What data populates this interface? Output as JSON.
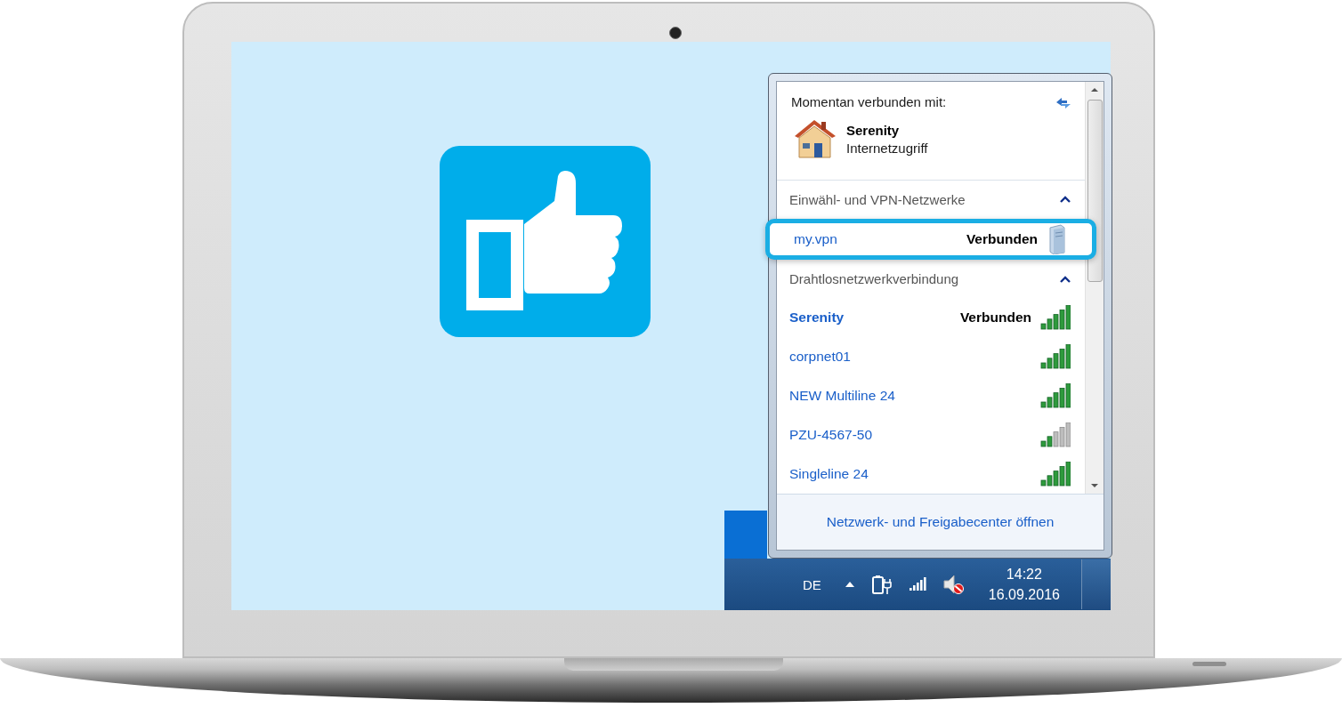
{
  "flyout": {
    "heading": "Momentan verbunden mit:",
    "current": {
      "name": "Serenity",
      "access": "Internetzugriff"
    },
    "sections": [
      {
        "title": "Einwähl- und VPN-Netzwerke",
        "kind": "vpn",
        "expanded": true,
        "items": [
          {
            "name": "my.vpn",
            "status": "Verbunden",
            "highlighted": true
          }
        ]
      },
      {
        "title": "Drahtlosnetzwerkverbindung",
        "kind": "wifi",
        "expanded": true,
        "items": [
          {
            "name": "Serenity",
            "status": "Verbunden",
            "connected": true,
            "level": 1
          },
          {
            "name": "corpnet01",
            "connected": false,
            "level": 1
          },
          {
            "name": "NEW Multiline 24",
            "connected": false,
            "level": 1
          },
          {
            "name": "PZU-4567-50",
            "connected": false,
            "level": 0.4
          },
          {
            "name": "Singleline 24",
            "connected": false,
            "level": 1
          }
        ]
      }
    ],
    "footer_link": "Netzwerk- und Freigabecenter öffnen"
  },
  "taskbar": {
    "language": "DE",
    "volume_muted": true,
    "time": "14:22",
    "date": "16.09.2016"
  }
}
